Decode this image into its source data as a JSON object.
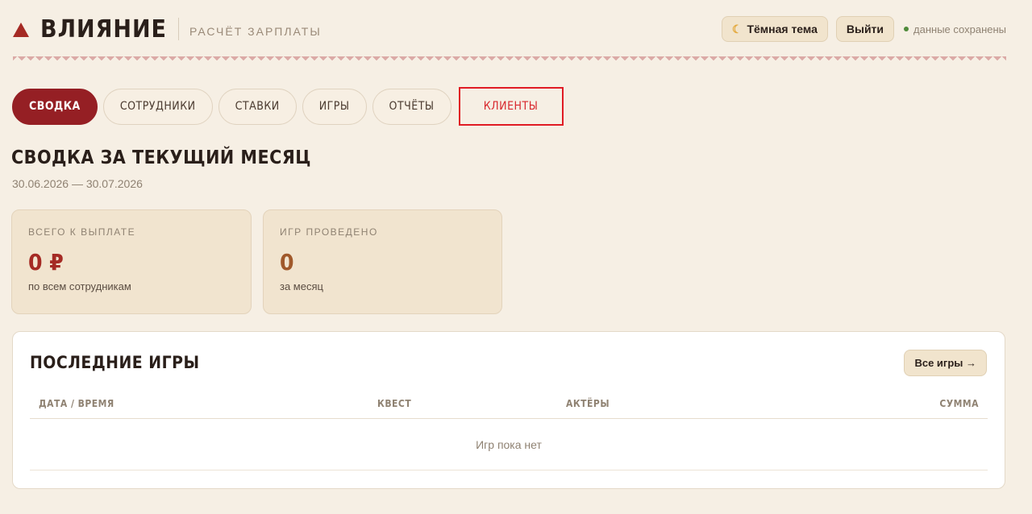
{
  "header": {
    "brand_name": "ВЛИЯНИЕ",
    "brand_sub": "РАСЧЁТ ЗАРПЛАТЫ",
    "theme_button": "Тёмная тема",
    "logout_button": "Выйти",
    "saved_status": "данные сохранены"
  },
  "tabs": [
    {
      "label": "СВОДКА",
      "active": true
    },
    {
      "label": "СОТРУДНИКИ",
      "active": false
    },
    {
      "label": "СТАВКИ",
      "active": false
    },
    {
      "label": "ИГРЫ",
      "active": false
    },
    {
      "label": "ОТЧЁТЫ",
      "active": false
    },
    {
      "label": "КЛИЕНТЫ",
      "active": false
    }
  ],
  "summary": {
    "title": "СВОДКА ЗА ТЕКУЩИЙ МЕСЯЦ",
    "range": "30.06.2026 — 30.07.2026"
  },
  "stats": [
    {
      "label": "ВСЕГО К ВЫПЛАТЕ",
      "value": "0 ₽",
      "sub": "по всем сотрудникам"
    },
    {
      "label": "ИГР ПРОВЕДЕНО",
      "value": "0",
      "sub": "за месяц"
    }
  ],
  "recent": {
    "title": "ПОСЛЕДНИЕ ИГРЫ",
    "all_button": "Все игры →",
    "columns": [
      "ДАТА / ВРЕМЯ",
      "КВЕСТ",
      "АКТЁРЫ",
      "СУММА"
    ],
    "empty_text": "Игр пока нет"
  },
  "colors": {
    "accent": "#951f24",
    "highlight_box": "#e01b24",
    "background": "#f6efe4"
  }
}
